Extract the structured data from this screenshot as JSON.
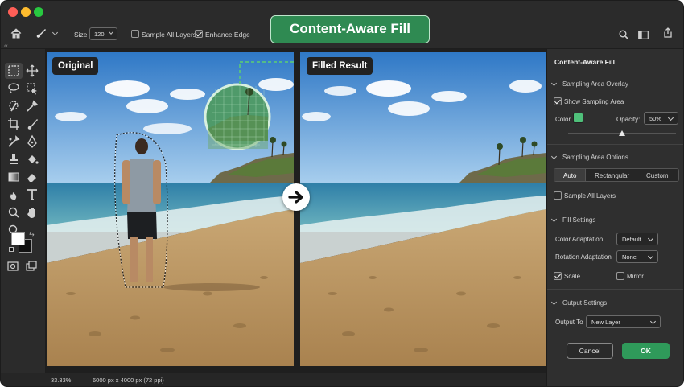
{
  "window": {
    "traffic_lights": [
      "#ff5f57",
      "#febc2e",
      "#28c840"
    ]
  },
  "topbar": {
    "size_label": "Size",
    "size_value": "120",
    "sample_all_layers": "Sample All Layers",
    "enhance_edge": "Enhance Edge",
    "callout": "Content-Aware Fill"
  },
  "toolbar": {
    "icons": [
      "marquee-icon",
      "move-icon",
      "lasso-icon",
      "object-select-icon",
      "quick-select-icon",
      "eyedropper-icon",
      "crop-icon",
      "brush-icon",
      "healing-icon",
      "pen-icon",
      "clone-stamp-icon",
      "eraser-icon",
      "gradient-icon",
      "burn-icon",
      "paint-bucket-icon",
      "type-icon",
      "zoom-icon",
      "hand-icon"
    ]
  },
  "canvas": {
    "left_label": "Original",
    "right_label": "Filled Result",
    "arrow": "→"
  },
  "panel": {
    "title": "Content-Aware Fill",
    "overlay_section": "Sampling Area Overlay",
    "show_sampling_area": "Show Sampling Area",
    "color_label": "Color",
    "overlay_color": "#4fc07a",
    "opacity_label": "Opacity:",
    "opacity_value": "50%",
    "opacity_level": 0.5,
    "options_section": "Sampling Area Options",
    "segments": [
      "Auto",
      "Rectangular",
      "Custom"
    ],
    "sample_all_layers": "Sample All Layers",
    "fill_section": "Fill Settings",
    "color_adaptation_label": "Color Adaptation",
    "color_adaptation_value": "Default",
    "rotation_adaptation_label": "Rotation Adaptation",
    "rotation_adaptation_value": "None",
    "scale_label": "Scale",
    "mirror_label": "Mirror",
    "output_section": "Output Settings",
    "output_to_label": "Output To",
    "output_to_value": "New Layer",
    "cancel": "Cancel",
    "ok": "OK",
    "accent": "#2f9a5a"
  },
  "status": {
    "zoom": "33.33%",
    "dimensions": "6000 px x 4000 px (72 ppi)"
  }
}
